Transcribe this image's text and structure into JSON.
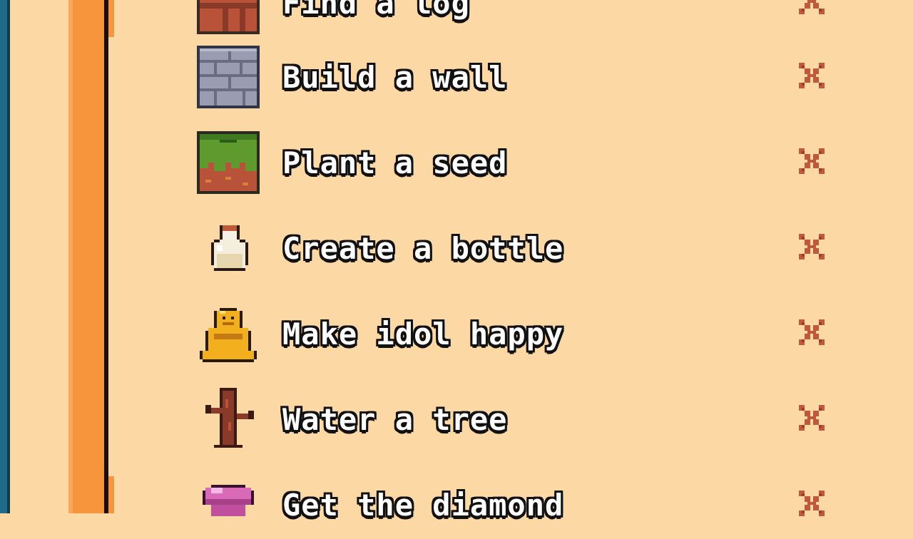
{
  "tasks": [
    {
      "label": "Find a log",
      "icon": "log-block-icon",
      "status": "incomplete"
    },
    {
      "label": "Build a wall",
      "icon": "stone-wall-icon",
      "status": "incomplete"
    },
    {
      "label": "Plant a seed",
      "icon": "grass-block-icon",
      "status": "incomplete"
    },
    {
      "label": "Create a bottle",
      "icon": "bottle-icon",
      "status": "incomplete"
    },
    {
      "label": "Make idol happy",
      "icon": "golden-idol-icon",
      "status": "incomplete"
    },
    {
      "label": "Water a tree",
      "icon": "tree-icon",
      "status": "incomplete"
    },
    {
      "label": "Get the diamond",
      "icon": "diamond-icon",
      "status": "incomplete"
    }
  ],
  "colors": {
    "background": "#fcd8a4",
    "status_x": "#c0583a",
    "frame_orange": "#f7953d",
    "frame_blue": "#1f6b8a"
  }
}
